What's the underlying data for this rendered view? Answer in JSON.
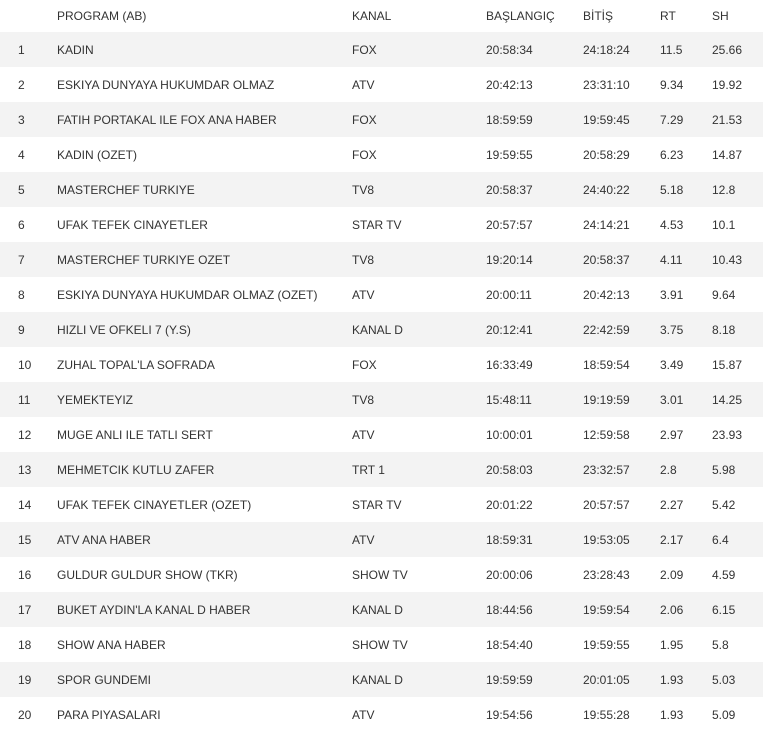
{
  "headers": {
    "rank": "",
    "program": "PROGRAM (AB)",
    "channel": "KANAL",
    "start": "BAŞLANGIÇ",
    "end": "BİTİŞ",
    "rt": "RT",
    "sh": "SH"
  },
  "rows": [
    {
      "rank": "1",
      "program": "KADIN",
      "channel": "FOX",
      "start": "20:58:34",
      "end": "24:18:24",
      "rt": "11.5",
      "sh": "25.66"
    },
    {
      "rank": "2",
      "program": "ESKIYA DUNYAYA HUKUMDAR OLMAZ",
      "channel": "ATV",
      "start": "20:42:13",
      "end": "23:31:10",
      "rt": "9.34",
      "sh": "19.92"
    },
    {
      "rank": "3",
      "program": "FATIH PORTAKAL ILE FOX ANA HABER",
      "channel": "FOX",
      "start": "18:59:59",
      "end": "19:59:45",
      "rt": "7.29",
      "sh": "21.53"
    },
    {
      "rank": "4",
      "program": "KADIN (OZET)",
      "channel": "FOX",
      "start": "19:59:55",
      "end": "20:58:29",
      "rt": "6.23",
      "sh": "14.87"
    },
    {
      "rank": "5",
      "program": "MASTERCHEF TURKIYE",
      "channel": "TV8",
      "start": "20:58:37",
      "end": "24:40:22",
      "rt": "5.18",
      "sh": "12.8"
    },
    {
      "rank": "6",
      "program": "UFAK TEFEK CINAYETLER",
      "channel": "STAR TV",
      "start": "20:57:57",
      "end": "24:14:21",
      "rt": "4.53",
      "sh": "10.1"
    },
    {
      "rank": "7",
      "program": "MASTERCHEF TURKIYE OZET",
      "channel": "TV8",
      "start": "19:20:14",
      "end": "20:58:37",
      "rt": "4.11",
      "sh": "10.43"
    },
    {
      "rank": "8",
      "program": "ESKIYA DUNYAYA HUKUMDAR OLMAZ (OZET)",
      "channel": "ATV",
      "start": "20:00:11",
      "end": "20:42:13",
      "rt": "3.91",
      "sh": "9.64"
    },
    {
      "rank": "9",
      "program": "HIZLI VE OFKELI 7 (Y.S)",
      "channel": "KANAL D",
      "start": "20:12:41",
      "end": "22:42:59",
      "rt": "3.75",
      "sh": "8.18"
    },
    {
      "rank": "10",
      "program": "ZUHAL TOPAL'LA SOFRADA",
      "channel": "FOX",
      "start": "16:33:49",
      "end": "18:59:54",
      "rt": "3.49",
      "sh": "15.87"
    },
    {
      "rank": "11",
      "program": "YEMEKTEYIZ",
      "channel": "TV8",
      "start": "15:48:11",
      "end": "19:19:59",
      "rt": "3.01",
      "sh": "14.25"
    },
    {
      "rank": "12",
      "program": "MUGE ANLI ILE TATLI SERT",
      "channel": "ATV",
      "start": "10:00:01",
      "end": "12:59:58",
      "rt": "2.97",
      "sh": "23.93"
    },
    {
      "rank": "13",
      "program": "MEHMETCIK KUTLU ZAFER",
      "channel": "TRT 1",
      "start": "20:58:03",
      "end": "23:32:57",
      "rt": "2.8",
      "sh": "5.98"
    },
    {
      "rank": "14",
      "program": "UFAK TEFEK CINAYETLER (OZET)",
      "channel": "STAR TV",
      "start": "20:01:22",
      "end": "20:57:57",
      "rt": "2.27",
      "sh": "5.42"
    },
    {
      "rank": "15",
      "program": "ATV ANA HABER",
      "channel": "ATV",
      "start": "18:59:31",
      "end": "19:53:05",
      "rt": "2.17",
      "sh": "6.4"
    },
    {
      "rank": "16",
      "program": "GULDUR GULDUR SHOW (TKR)",
      "channel": "SHOW TV",
      "start": "20:00:06",
      "end": "23:28:43",
      "rt": "2.09",
      "sh": "4.59"
    },
    {
      "rank": "17",
      "program": "BUKET AYDIN'LA KANAL D HABER",
      "channel": "KANAL D",
      "start": "18:44:56",
      "end": "19:59:54",
      "rt": "2.06",
      "sh": "6.15"
    },
    {
      "rank": "18",
      "program": "SHOW ANA HABER",
      "channel": "SHOW TV",
      "start": "18:54:40",
      "end": "19:59:55",
      "rt": "1.95",
      "sh": "5.8"
    },
    {
      "rank": "19",
      "program": "SPOR GUNDEMI",
      "channel": "KANAL D",
      "start": "19:59:59",
      "end": "20:01:05",
      "rt": "1.93",
      "sh": "5.03"
    },
    {
      "rank": "20",
      "program": "PARA PIYASALARI",
      "channel": "ATV",
      "start": "19:54:56",
      "end": "19:55:28",
      "rt": "1.93",
      "sh": "5.09"
    }
  ]
}
